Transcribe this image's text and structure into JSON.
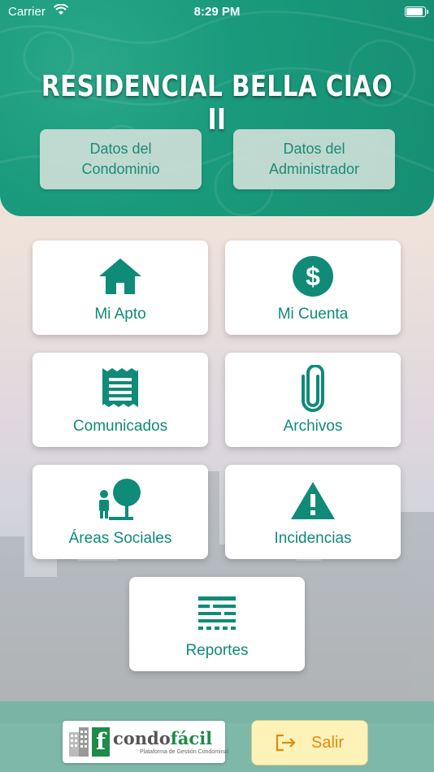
{
  "status_bar": {
    "carrier": "Carrier",
    "time": "8:29 PM",
    "battery_level": 0.85
  },
  "header": {
    "title": "RESIDENCIAL BELLA CIAO II",
    "buttons": [
      {
        "label": "Datos del Condominio"
      },
      {
        "label": "Datos del Administrador"
      }
    ]
  },
  "menu": [
    {
      "label": "Mi Apto",
      "icon": "home-icon"
    },
    {
      "label": "Mi Cuenta",
      "icon": "dollar-icon"
    },
    {
      "label": "Comunicados",
      "icon": "receipt-icon"
    },
    {
      "label": "Archivos",
      "icon": "paperclip-icon"
    },
    {
      "label": "Áreas Sociales",
      "icon": "park-icon"
    },
    {
      "label": "Incidencias",
      "icon": "warning-icon"
    },
    {
      "label": "Reportes",
      "icon": "reports-icon"
    }
  ],
  "footer": {
    "logo": {
      "brand_prefix": "condo",
      "brand_suffix": "fácil",
      "letter": "f",
      "tagline": "Plataforma de Gestión Condominal"
    },
    "exit_label": "Salir"
  },
  "colors": {
    "primary": "#168f73",
    "text_accent": "#108a78",
    "exit_bg": "#fdf3b8",
    "exit_text": "#e48a0c"
  }
}
